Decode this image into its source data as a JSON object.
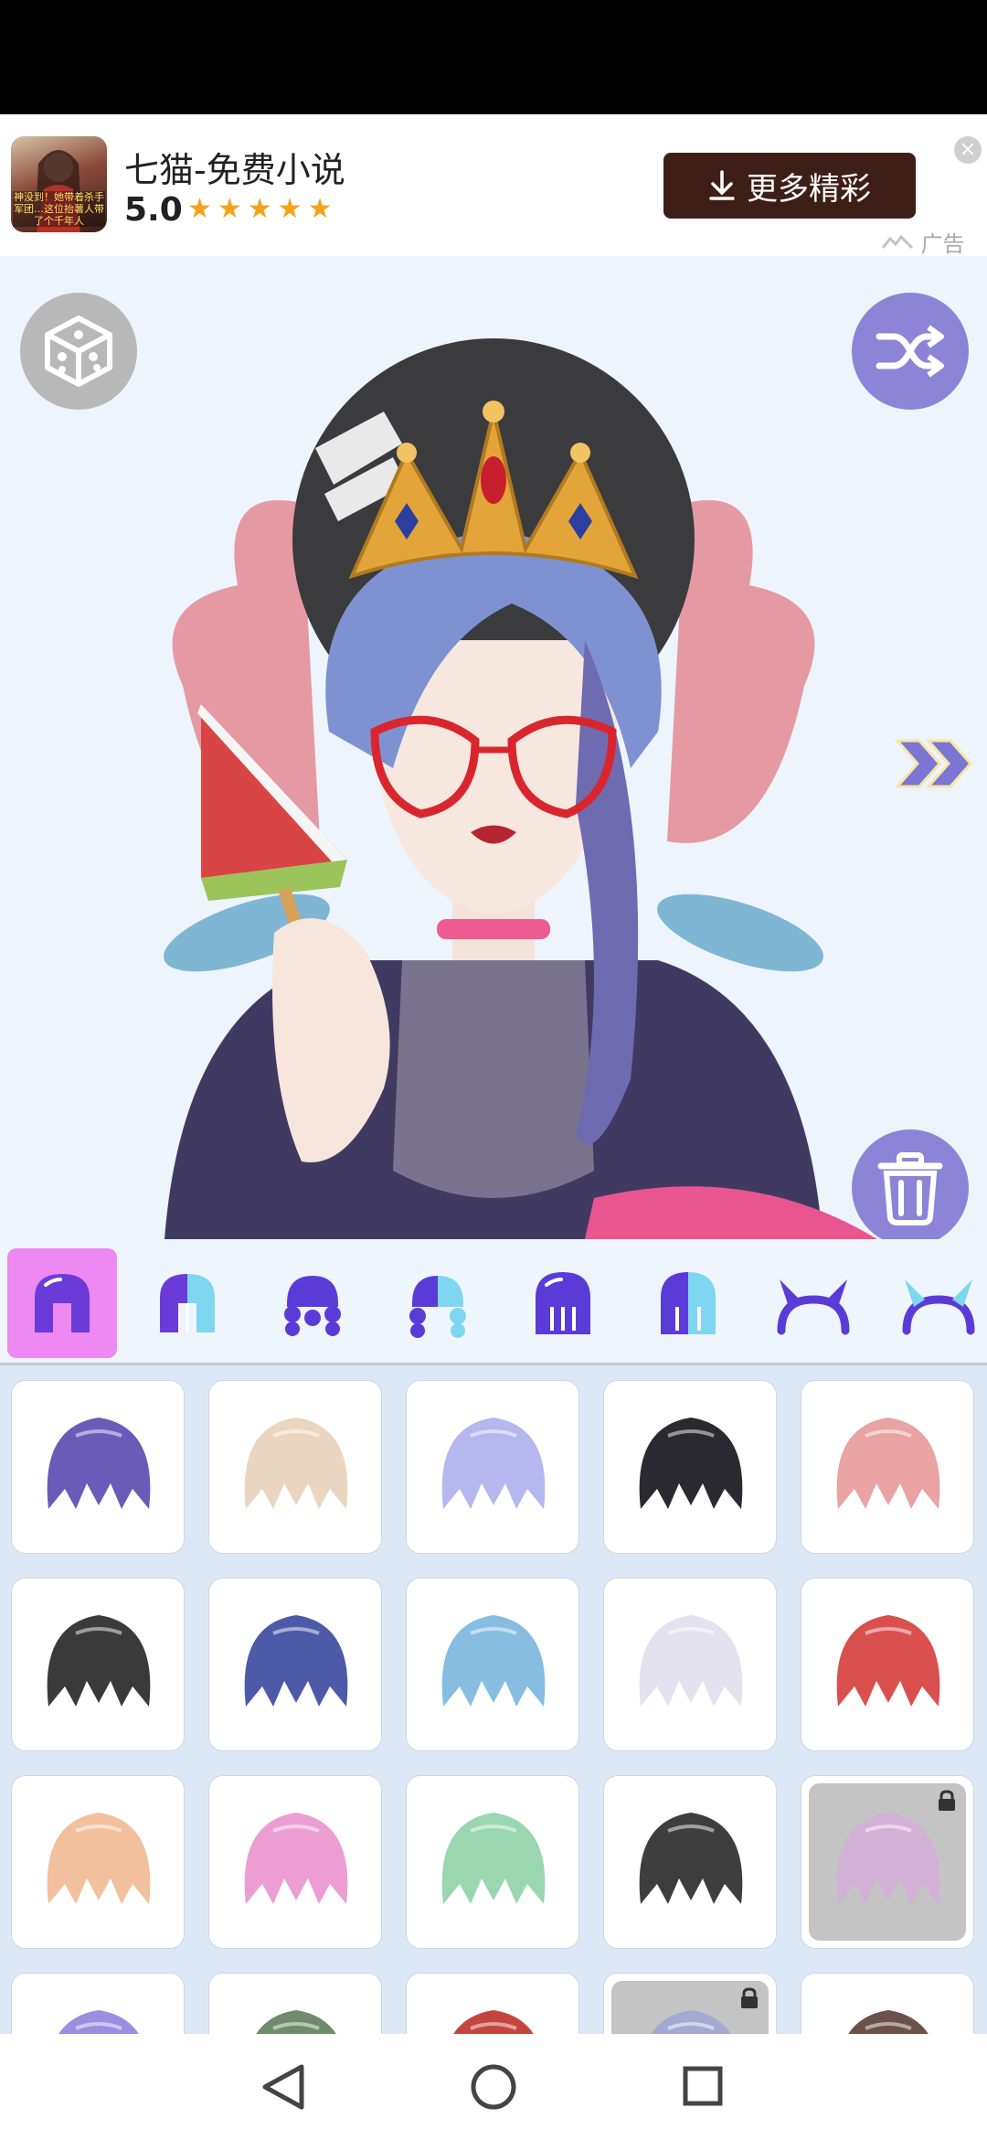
{
  "ad": {
    "thumb_caption": "神没到！她带着杀手军团…这位抬薯人带了个千年人",
    "title": "七猫-免费小说",
    "rating": "5.0",
    "stars": "★★★★★",
    "button_label": "更多精彩",
    "close_glyph": "×",
    "ad_label": "广告"
  },
  "canvas": {
    "background": "#edf4fc",
    "accent": "#8d84d8"
  },
  "tabs": [
    {
      "name": "hair-front",
      "active": true
    },
    {
      "name": "hair-front-two-tone",
      "active": false
    },
    {
      "name": "hair-back",
      "active": false
    },
    {
      "name": "hair-back-two-tone",
      "active": false
    },
    {
      "name": "hair-long",
      "active": false
    },
    {
      "name": "hair-long-two-tone",
      "active": false
    },
    {
      "name": "horns",
      "active": false
    },
    {
      "name": "horns-two-tone",
      "active": false
    }
  ],
  "items": [
    {
      "color": "#6a5bb8",
      "locked": false
    },
    {
      "color": "#ead6c0",
      "locked": false
    },
    {
      "color": "#b6b7ee",
      "locked": false
    },
    {
      "color": "#2a2a30",
      "locked": false
    },
    {
      "color": "#e9a3a3",
      "locked": false
    },
    {
      "color": "#3a3a3a",
      "locked": false
    },
    {
      "color": "#4c5aa8",
      "locked": false
    },
    {
      "color": "#86bde0",
      "locked": false
    },
    {
      "color": "#e4e2ee",
      "locked": false
    },
    {
      "color": "#d9504e",
      "locked": false
    },
    {
      "color": "#f2c09c",
      "locked": false
    },
    {
      "color": "#ec9ed3",
      "locked": false
    },
    {
      "color": "#9ad7b0",
      "locked": false
    },
    {
      "color": "#3e3e3e",
      "locked": false
    },
    {
      "color": "#d8a9dc",
      "locked": true
    },
    {
      "color": "#9b8ee0",
      "locked": false
    },
    {
      "color": "#6e8c6c",
      "locked": false
    },
    {
      "color": "#c4453e",
      "locked": false
    },
    {
      "color": "#9aa0d8",
      "locked": true
    },
    {
      "color": "#6b5148",
      "locked": false
    }
  ]
}
